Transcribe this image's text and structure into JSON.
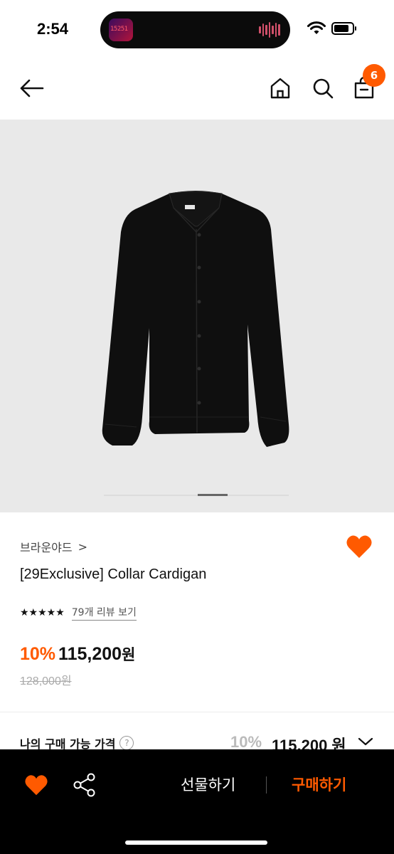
{
  "status_bar": {
    "time": "2:54",
    "live_activity_text": "15251"
  },
  "nav": {
    "cart_count": "6"
  },
  "product": {
    "brand": "브라운야드",
    "brand_chevron": ">",
    "name": "[29Exclusive] Collar Cardigan",
    "stars": "★★★★★",
    "rating_value": 5,
    "review_link": "79개 리뷰 보기",
    "discount": "10%",
    "price": "115,200",
    "currency": "원",
    "original_price": "128,000원"
  },
  "gallery": {
    "current_page": 2,
    "total_pages": 3
  },
  "my_price": {
    "label": "나의 구매 가능 가격",
    "help": "?",
    "discount": "10%",
    "price": "115,200 원"
  },
  "bottom_bar": {
    "gift_label": "선물하기",
    "buy_label": "구매하기"
  },
  "colors": {
    "accent": "#ff5a00",
    "bar_bg": "#000000",
    "hero_bg": "#e9e9e9"
  }
}
